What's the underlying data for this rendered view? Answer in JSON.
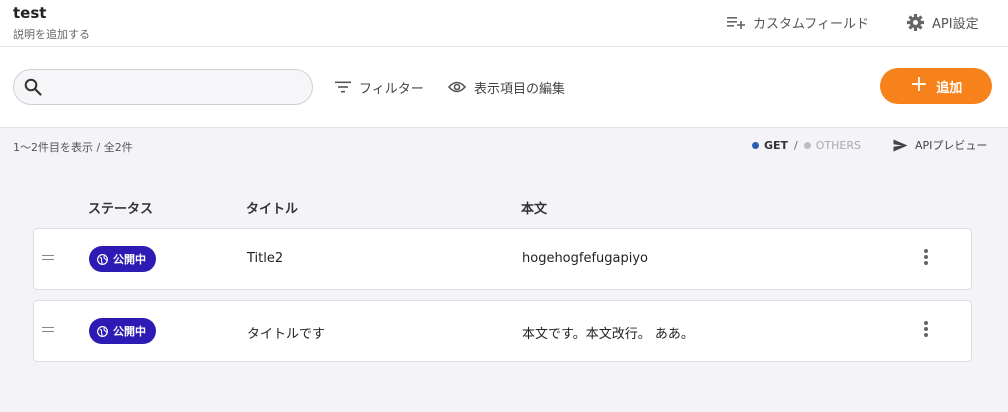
{
  "header": {
    "title": "test",
    "subtitle": "説明を追加する",
    "custom_field_label": "カスタムフィールド",
    "api_settings_label": "API設定"
  },
  "toolbar": {
    "search_value": "",
    "filter_label": "フィルター",
    "edit_columns_label": "表示項目の編集",
    "add_label": "追加"
  },
  "summary": {
    "count_text": "1〜2件目を表示 / 全2件",
    "get_label": "GET",
    "separator": "/",
    "others_label": "OTHERS",
    "api_preview_label": "APIプレビュー"
  },
  "table": {
    "columns": [
      "ステータス",
      "タイトル",
      "本文"
    ],
    "rows": [
      {
        "status": "公開中",
        "title": "Title2",
        "body": "hogehogfefugapiyo"
      },
      {
        "status": "公開中",
        "title": "タイトルです",
        "body": "本文です。本文改行。 ああ。"
      }
    ]
  },
  "colors": {
    "accent": "#f7821b",
    "published_badge": "#2d1bb3",
    "get_dot": "#2a5db0",
    "others_dot": "#bdbdc4"
  },
  "icons": [
    "playlist-add-icon",
    "gear-icon",
    "search-icon",
    "filter-icon",
    "eye-icon",
    "plus-icon",
    "send-icon",
    "globe-icon",
    "drag-handle-icon",
    "kebab-icon"
  ]
}
